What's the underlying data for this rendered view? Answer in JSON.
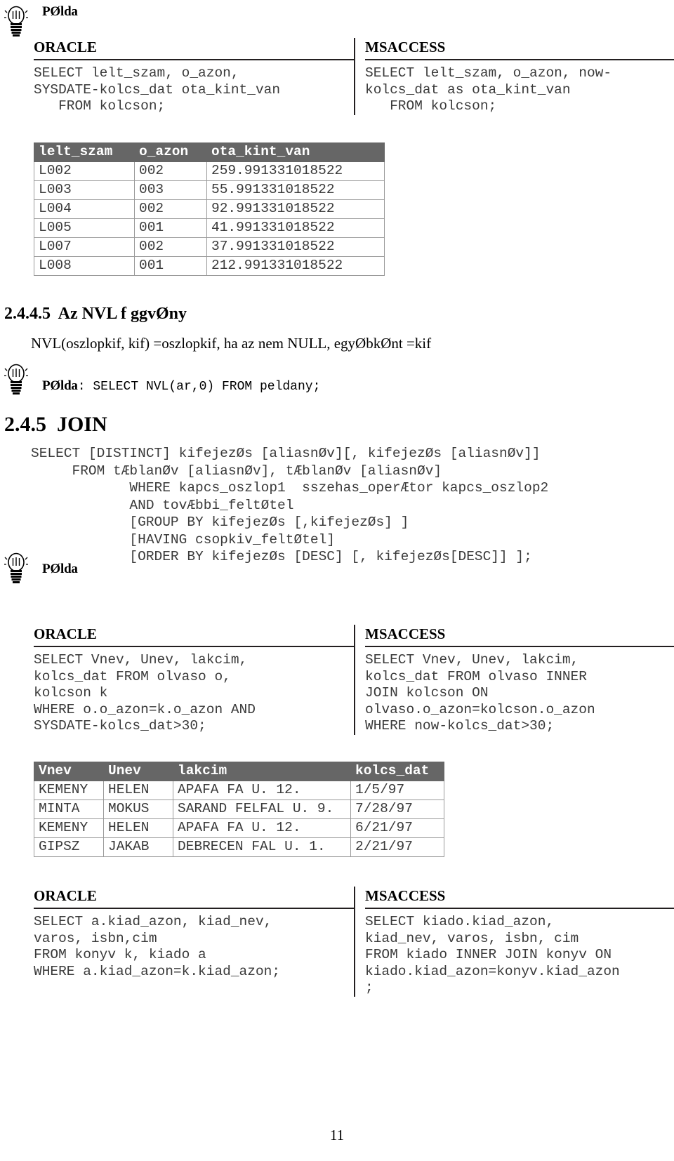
{
  "page": {
    "number": "11"
  },
  "tips": {
    "label_top": "PØlda",
    "label_nvl": "PØlda",
    "nvl_code": ": SELECT NVL(ar,0) FROM peldany;",
    "label_join": "PØlda"
  },
  "block1": {
    "oracle": {
      "title": "ORACLE",
      "code": "SELECT lelt_szam, o_azon,\nSYSDATE-kolcs_dat ota_kint_van\n   FROM kolcson;"
    },
    "msaccess": {
      "title": "MSACCESS",
      "code": "SELECT lelt_szam, o_azon, now-\nkolcs_dat as ota_kint_van\n   FROM kolcson;"
    }
  },
  "table1": {
    "headers": [
      "lelt_szam",
      "o_azon",
      "ota_kint_van"
    ],
    "rows": [
      [
        "L002",
        "002",
        "259.991331018522"
      ],
      [
        "L003",
        "003",
        "55.991331018522"
      ],
      [
        "L004",
        "002",
        "92.991331018522"
      ],
      [
        "L005",
        "001",
        "41.991331018522"
      ],
      [
        "L007",
        "002",
        "37.991331018522"
      ],
      [
        "L008",
        "001",
        "212.991331018522"
      ]
    ]
  },
  "section_nvl": {
    "heading": "2.4.4.5  Az NVL f ggvØny",
    "description": "NVL(oszlopkif, kif) =oszlopkif, ha az nem NULL, egyØbkØnt =kif"
  },
  "section_join": {
    "heading": "2.4.5  JOIN",
    "syntax": "SELECT [DISTINCT] kifejezØs [aliasnØv][, kifejezØs [aliasnØv]]\n     FROM tÆblanØv [aliasnØv], tÆblanØv [aliasnØv]\n            WHERE kapcs_oszlop1  sszehas_operÆtor kapcs_oszlop2\n            AND tovÆbbi_feltØtel\n            [GROUP BY kifejezØs [,kifejezØs] ]\n            [HAVING csopkiv_feltØtel]\n            [ORDER BY kifejezØs [DESC] [, kifejezØs[DESC]] ];"
  },
  "block2": {
    "oracle": {
      "title": "ORACLE",
      "code": "SELECT Vnev, Unev, lakcim,\nkolcs_dat FROM olvaso o,\nkolcson k\nWHERE o.o_azon=k.o_azon AND\nSYSDATE-kolcs_dat>30;"
    },
    "msaccess": {
      "title": "MSACCESS",
      "code": "SELECT Vnev, Unev, lakcim,\nkolcs_dat FROM olvaso INNER\nJOIN kolcson ON\nolvaso.o_azon=kolcson.o_azon\nWHERE now-kolcs_dat>30;"
    }
  },
  "table2": {
    "headers": [
      "Vnev",
      "Unev",
      "lakcim",
      "kolcs_dat"
    ],
    "rows": [
      [
        "KEMENY",
        "HELEN",
        "APAFA FA U. 12.",
        "1/5/97"
      ],
      [
        "MINTA",
        "MOKUS",
        "SARAND FELFAL U. 9.",
        "7/28/97"
      ],
      [
        "KEMENY",
        "HELEN",
        "APAFA FA U. 12.",
        "6/21/97"
      ],
      [
        "GIPSZ",
        "JAKAB",
        "DEBRECEN FAL U. 1.",
        "2/21/97"
      ]
    ]
  },
  "block3": {
    "oracle": {
      "title": "ORACLE",
      "code": "SELECT a.kiad_azon, kiad_nev,\nvaros, isbn,cim\nFROM konyv k, kiado a\nWHERE a.kiad_azon=k.kiad_azon;"
    },
    "msaccess": {
      "title": "MSACCESS",
      "code": "SELECT kiado.kiad_azon,\nkiad_nev, varos, isbn, cim\nFROM kiado INNER JOIN konyv ON\nkiado.kiad_azon=konyv.kiad_azon\n;"
    }
  }
}
